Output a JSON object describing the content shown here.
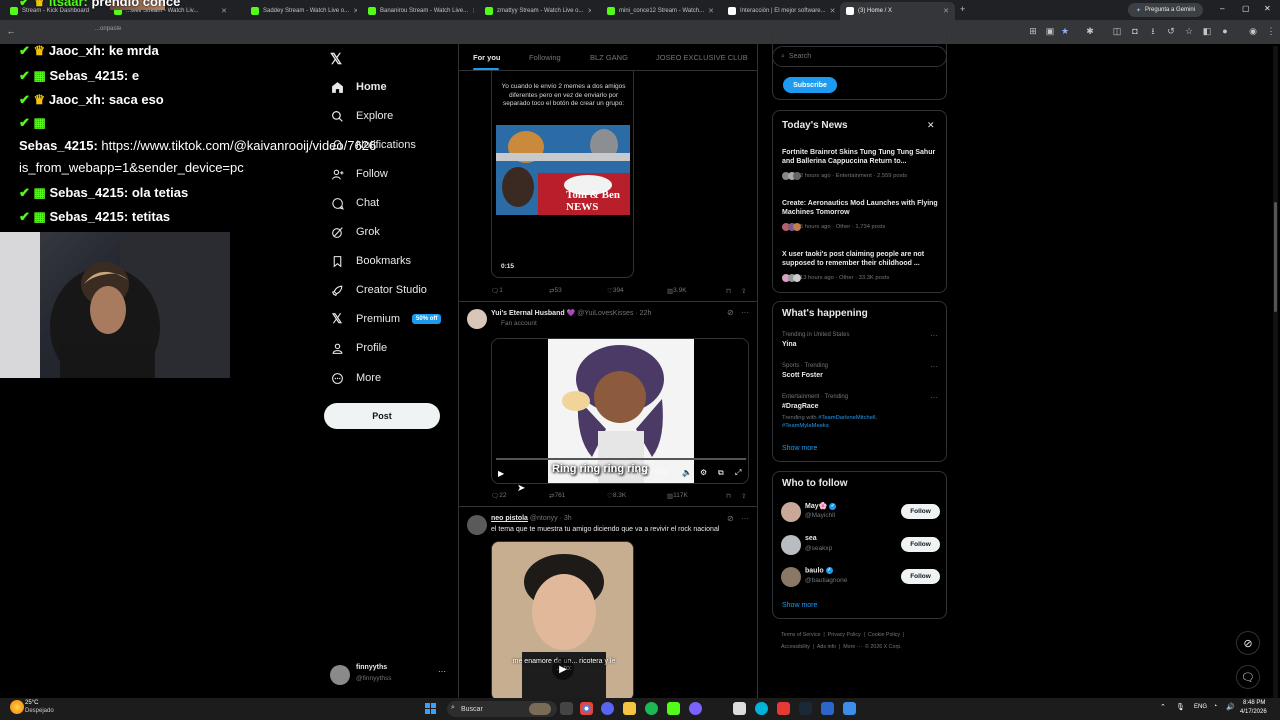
{
  "browser": {
    "tabs": [
      {
        "label": "Stream - Kick Dashboard",
        "fav": "#53fc18"
      },
      {
        "label": "...well Stream - Watch Liv...",
        "fav": "#53fc18"
      },
      {
        "label": "Saddey Stream - Watch Live o...",
        "fav": "#53fc18"
      },
      {
        "label": "Bananirou Stream - Watch Live...",
        "fav": "#53fc18"
      },
      {
        "label": "zmattyy Stream - Watch Live o...",
        "fav": "#53fc18"
      },
      {
        "label": "mini_conce12 Stream - Watch...",
        "fav": "#53fc18"
      },
      {
        "label": "Interacción | El mejor software...",
        "fav": "#ffffff"
      },
      {
        "label": "(3) Home / X",
        "fav": "#ffffff"
      }
    ],
    "gemini_label": "Pregunta a Gemini",
    "address_text": "...onpaste"
  },
  "chat": {
    "messages": [
      {
        "user": "itsaar:",
        "text": "prendio conce",
        "badges": [
          "k",
          "c"
        ]
      },
      {
        "user": "Jaoc_xh:",
        "text": "ke mrda",
        "badges": [
          "s",
          "c"
        ]
      },
      {
        "user": "Sebas_4215:",
        "text": "e",
        "badges": [
          "s",
          "k"
        ]
      },
      {
        "user": "Jaoc_xh:",
        "text": "saca eso",
        "badges": [
          "s",
          "c"
        ]
      },
      {
        "user": "",
        "text": "",
        "badges": [
          "s",
          "k"
        ]
      },
      {
        "user": "Sebas_4215:",
        "text": "https://www.tiktok.com/@kaivanrooij/video/7626",
        "badges": []
      },
      {
        "user": "",
        "text": "is_from_webapp=1&sender_device=pc",
        "badges": []
      },
      {
        "user": "Sebas_4215:",
        "text": "ola tetias",
        "badges": [
          "s",
          "k"
        ]
      },
      {
        "user": "Sebas_4215:",
        "text": "tetitas",
        "badges": [
          "s",
          "k"
        ]
      }
    ]
  },
  "nav": {
    "items": [
      {
        "label": "Home",
        "icon": "home-icon"
      },
      {
        "label": "Explore",
        "icon": "search-icon"
      },
      {
        "label": "Notifications",
        "icon": "bell-icon"
      },
      {
        "label": "Follow",
        "icon": "person-add-icon"
      },
      {
        "label": "Chat",
        "icon": "chat-icon"
      },
      {
        "label": "Grok",
        "icon": "grok-icon"
      },
      {
        "label": "Bookmarks",
        "icon": "bookmark-icon"
      },
      {
        "label": "Creator Studio",
        "icon": "rocket-icon"
      },
      {
        "label": "Premium",
        "icon": "x-logo-icon"
      },
      {
        "label": "Profile",
        "icon": "person-icon"
      },
      {
        "label": "More",
        "icon": "more-circle-icon"
      }
    ],
    "premium_badge": "50% off",
    "post_label": "Post",
    "account": {
      "name": "finnyyths",
      "handle": "@finnyythss"
    }
  },
  "feed": {
    "tabs": [
      "For you",
      "Following",
      "BLZ GANG",
      "JOSEO EXCLUSIVE CLUB"
    ],
    "post1": {
      "meme_caption": "Yo cuando le envío 2 memes a dos amigos diferentes pero en vez de enviarlo por separado toco el botón de crear un grupo:",
      "news_banner": "Tom & Ben NEWS",
      "duration": "0:15",
      "stats": {
        "replies": "1",
        "reposts": "53",
        "likes": "394",
        "views": "3.9K"
      }
    },
    "post2": {
      "name": "Yui's Eternal Husband",
      "handle": "@YuiLovesKisses",
      "time": "22h",
      "label": "Fan account",
      "video_caption": "Ring ring ring ring",
      "video_time": "0:00 / 0:12",
      "stats": {
        "replies": "22",
        "reposts": "761",
        "likes": "8.3K",
        "views": "117K"
      }
    },
    "post3": {
      "name": "neo pistola",
      "handle": "@ntonyy",
      "time": "3h",
      "text": "el tema que te muestra tu amigo diciendo que va a revivir el rock nacional",
      "video_caption": "me enamore de un... ricotera y le ... to:"
    }
  },
  "right": {
    "search_placeholder": "Search",
    "subscribe_label": "Subscribe",
    "news": {
      "title": "Today's News",
      "items": [
        {
          "title": "Fortnite Brainrot Skins Tung Tung Tung Sahur and Ballerina Cappuccina Return to...",
          "meta": "2 hours ago · Entertainment · 2,559 posts"
        },
        {
          "title": "Create: Aeronautics Mod Launches with Flying Machines Tomorrow",
          "meta": "5 hours ago · Other · 1,734 posts"
        },
        {
          "title": "X user taoki's post claiming people are not supposed to remember their childhood ...",
          "meta": "13 hours ago · Other · 33.3K posts"
        }
      ]
    },
    "happening": {
      "title": "What's happening",
      "items": [
        {
          "context": "Trending in United States",
          "topic": "Yina",
          "extra": ""
        },
        {
          "context": "Sports · Trending",
          "topic": "Scott Foster",
          "extra": ""
        },
        {
          "context": "Entertainment · Trending",
          "topic": "#DragRace",
          "extra": "Trending with #TeamDarleneMitchell, #TeamMylaMeeks"
        }
      ],
      "show_more": "Show more"
    },
    "who": {
      "title": "Who to follow",
      "items": [
        {
          "name": "May🌸",
          "handle": "@Mayichll",
          "verified": true
        },
        {
          "name": "sea",
          "handle": "@seakxp",
          "verified": false
        },
        {
          "name": "baulo",
          "handle": "@bautiagnone",
          "verified": true
        }
      ],
      "follow_label": "Follow",
      "show_more": "Show more"
    },
    "footer": [
      "Terms of Service",
      "Privacy Policy",
      "Cookie Policy",
      "Accessibility",
      "Ads info",
      "More ···",
      "© 2026 X Corp."
    ]
  },
  "taskbar": {
    "weather_temp": "25°C",
    "weather_desc": "Despejado",
    "search_label": "Buscar",
    "lang": "ENG",
    "time": "8:48 PM",
    "date": "4/17/2026"
  }
}
